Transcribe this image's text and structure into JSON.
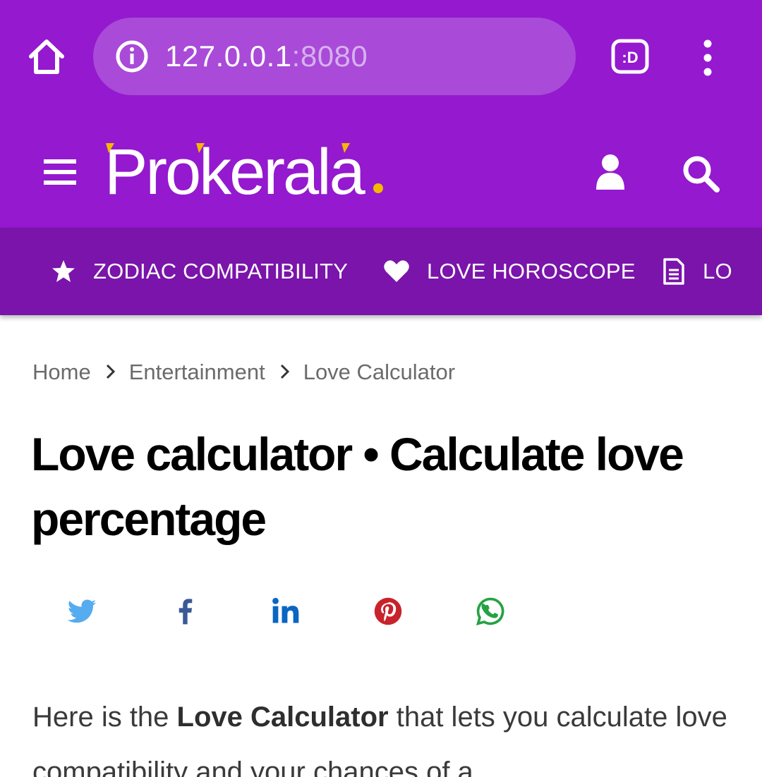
{
  "browser": {
    "url_host": "127.0.0.1",
    "url_port": ":8080"
  },
  "header": {
    "logo_text": "Prokerala"
  },
  "subnav": {
    "items": [
      {
        "label": "ZODIAC COMPATIBILITY",
        "icon": "star-icon"
      },
      {
        "label": "LOVE HOROSCOPE",
        "icon": "heart-icon"
      },
      {
        "label": "LO",
        "icon": "document-icon"
      }
    ]
  },
  "breadcrumb": {
    "items": [
      "Home",
      "Entertainment",
      "Love Calculator"
    ]
  },
  "page": {
    "title": "Love calculator • Calculate love percentage",
    "intro_before": "Here is the ",
    "intro_bold": "Love Calculator",
    "intro_after": " that lets you calculate love compatibility and your chances of a"
  },
  "share": {
    "items": [
      "twitter",
      "facebook",
      "linkedin",
      "pinterest",
      "whatsapp"
    ]
  },
  "colors": {
    "brand_purple": "#9419cf",
    "subnav_purple": "#7a14aa",
    "logo_accent": "#f5b800",
    "twitter": "#55acee",
    "facebook": "#3b5998",
    "linkedin": "#0a66c2",
    "pinterest": "#c8232c",
    "whatsapp": "#25a244"
  }
}
